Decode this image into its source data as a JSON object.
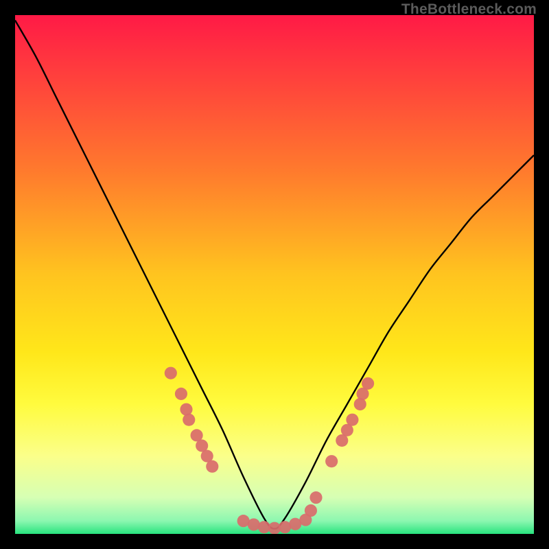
{
  "watermark": "TheBottleneck.com",
  "chart_data": {
    "type": "line",
    "title": "",
    "xlabel": "",
    "ylabel": "",
    "xlim": [
      0,
      100
    ],
    "ylim": [
      0,
      100
    ],
    "background_gradient_stops": [
      {
        "offset": 0,
        "color": "#ff1a46"
      },
      {
        "offset": 0.1,
        "color": "#ff3a3e"
      },
      {
        "offset": 0.3,
        "color": "#ff7a2d"
      },
      {
        "offset": 0.5,
        "color": "#ffc41f"
      },
      {
        "offset": 0.65,
        "color": "#ffe71a"
      },
      {
        "offset": 0.75,
        "color": "#fffb3e"
      },
      {
        "offset": 0.85,
        "color": "#fbff8a"
      },
      {
        "offset": 0.93,
        "color": "#d6ffb4"
      },
      {
        "offset": 0.975,
        "color": "#8cf7b0"
      },
      {
        "offset": 1.0,
        "color": "#28e47e"
      }
    ],
    "series": [
      {
        "name": "bottleneck-curve",
        "color": "#000000",
        "x": [
          0,
          4,
          8,
          12,
          16,
          20,
          24,
          28,
          32,
          36,
          40,
          44,
          48,
          50,
          52,
          56,
          60,
          64,
          68,
          72,
          76,
          80,
          84,
          88,
          92,
          96,
          100
        ],
        "y": [
          99,
          92,
          84,
          76,
          68,
          60,
          52,
          44,
          36,
          28,
          20,
          11,
          3,
          1,
          3,
          10,
          18,
          25,
          32,
          39,
          45,
          51,
          56,
          61,
          65,
          69,
          73
        ]
      }
    ],
    "scatter_points": {
      "name": "fit-markers",
      "color": "#d96b6b",
      "radius": 1.2,
      "points": [
        {
          "x": 30,
          "y": 31
        },
        {
          "x": 32,
          "y": 27
        },
        {
          "x": 33,
          "y": 24
        },
        {
          "x": 33.5,
          "y": 22
        },
        {
          "x": 35,
          "y": 19
        },
        {
          "x": 36,
          "y": 17
        },
        {
          "x": 37,
          "y": 15
        },
        {
          "x": 38,
          "y": 13
        },
        {
          "x": 44,
          "y": 2.5
        },
        {
          "x": 46,
          "y": 1.8
        },
        {
          "x": 48,
          "y": 1.3
        },
        {
          "x": 50,
          "y": 1.1
        },
        {
          "x": 52,
          "y": 1.3
        },
        {
          "x": 54,
          "y": 1.9
        },
        {
          "x": 56,
          "y": 2.7
        },
        {
          "x": 57,
          "y": 4.5
        },
        {
          "x": 58,
          "y": 7
        },
        {
          "x": 61,
          "y": 14
        },
        {
          "x": 63,
          "y": 18
        },
        {
          "x": 64,
          "y": 20
        },
        {
          "x": 65,
          "y": 22
        },
        {
          "x": 66.5,
          "y": 25
        },
        {
          "x": 67,
          "y": 27
        },
        {
          "x": 68,
          "y": 29
        }
      ]
    }
  }
}
